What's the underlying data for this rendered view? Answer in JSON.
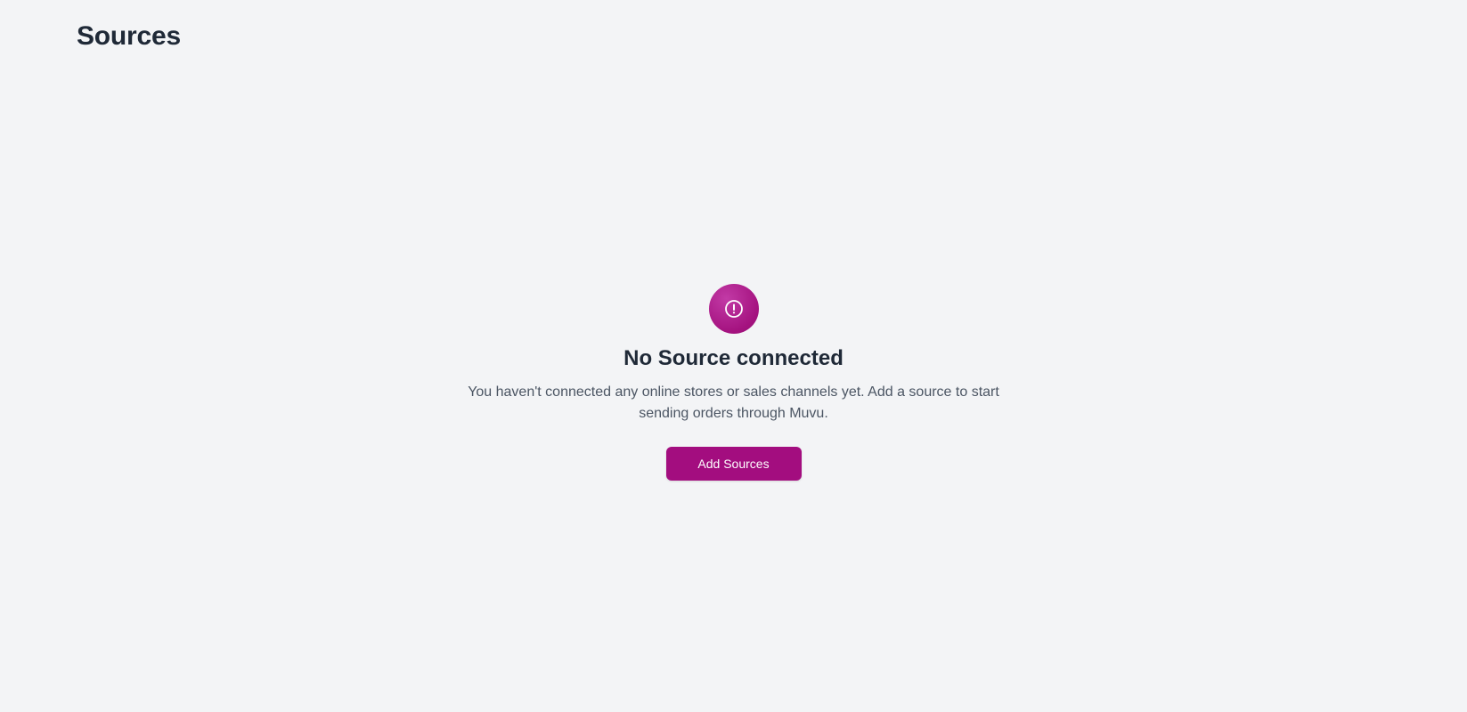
{
  "header": {
    "title": "Sources"
  },
  "empty_state": {
    "icon": "exclamation-circle-icon",
    "heading": "No Source connected",
    "description": "You haven't connected any online stores or sales channels yet. Add a source to start sending orders through Muvu.",
    "button_label": "Add Sources"
  },
  "colors": {
    "accent": "#a30d7f",
    "background": "#f3f4f6",
    "heading_text": "#1f2937",
    "body_text": "#4b5563"
  }
}
